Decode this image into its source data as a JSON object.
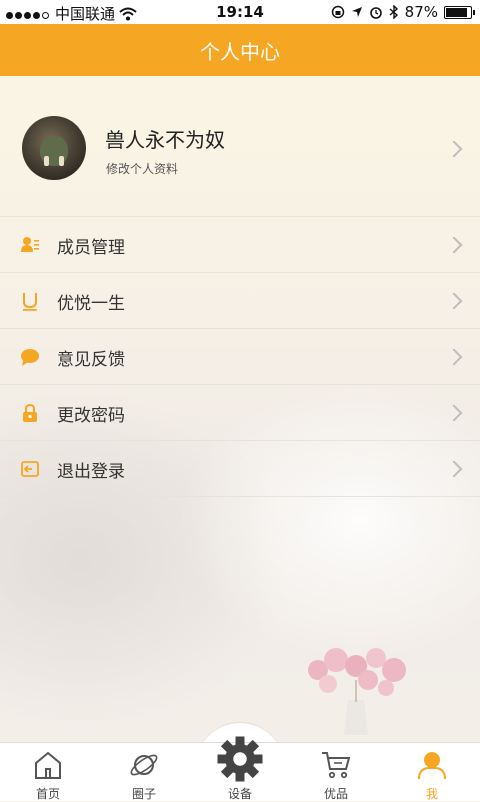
{
  "status_bar": {
    "carrier": "中国联通",
    "time": "19:14",
    "battery": "87%",
    "battery_level": 0.87
  },
  "header": {
    "title": "个人中心"
  },
  "profile": {
    "name": "兽人永不为奴",
    "subtitle": "修改个人资料"
  },
  "menu": {
    "items": [
      {
        "label": "成员管理",
        "icon": "members-icon"
      },
      {
        "label": "优悦一生",
        "icon": "u-logo-icon"
      },
      {
        "label": "意见反馈",
        "icon": "chat-bubble-icon"
      },
      {
        "label": "更改密码",
        "icon": "lock-icon"
      },
      {
        "label": "退出登录",
        "icon": "logout-icon"
      }
    ]
  },
  "tabbar": {
    "tabs": [
      {
        "label": "首页",
        "icon": "home-icon"
      },
      {
        "label": "圈子",
        "icon": "planet-icon"
      },
      {
        "label": "设备",
        "icon": "gear-icon"
      },
      {
        "label": "优品",
        "icon": "cart-icon"
      },
      {
        "label": "我",
        "icon": "user-icon",
        "active": true
      }
    ]
  },
  "colors": {
    "accent": "#f5a623",
    "text": "#333333",
    "divider": "#e8e3da"
  }
}
